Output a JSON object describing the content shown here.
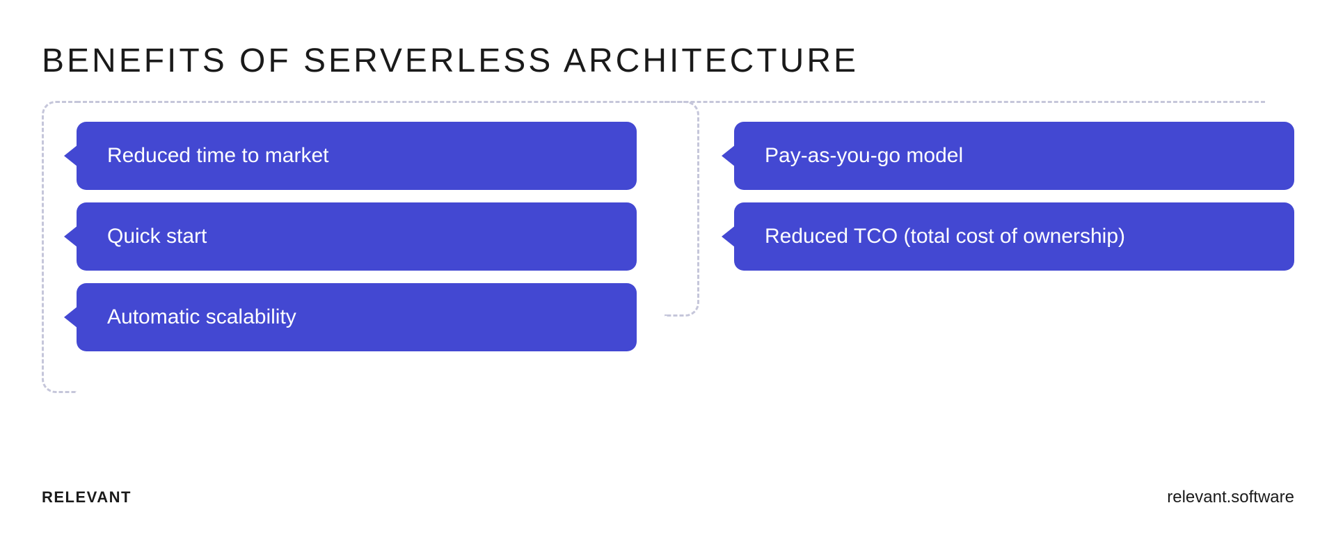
{
  "title": "BENEFITS OF SERVERLESS ARCHITECTURE",
  "benefits": {
    "left": [
      "Reduced time to market",
      "Quick start",
      "Automatic scalability"
    ],
    "right": [
      "Pay-as-you-go model",
      "Reduced TCO (total cost of ownership)"
    ]
  },
  "footer": {
    "brand": "RELEVANT",
    "website": "relevant.software"
  },
  "colors": {
    "primary": "#4348d2",
    "dashed": "#c5c6da",
    "text": "#1a1a1a"
  }
}
